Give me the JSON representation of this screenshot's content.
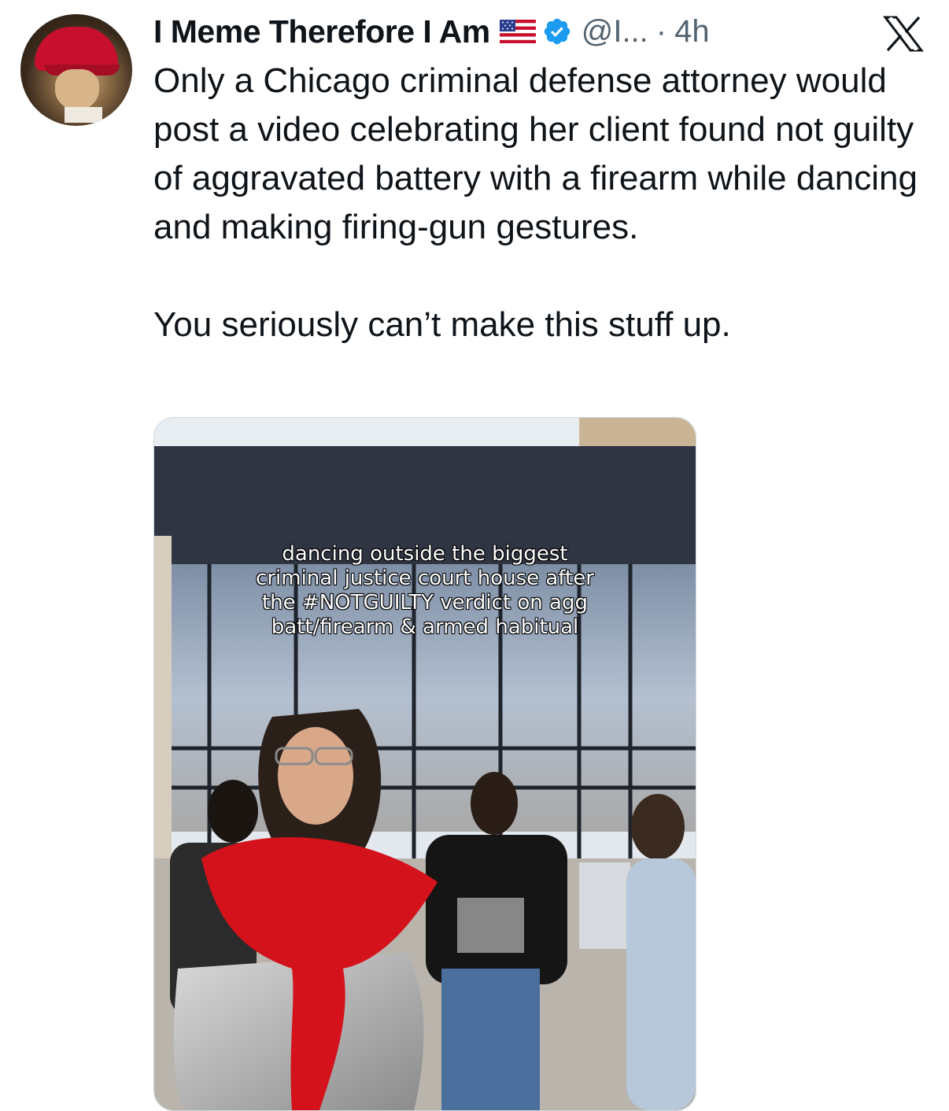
{
  "author": {
    "display_name": "I Meme Therefore I Am",
    "handle": "@I...",
    "separator": "·",
    "timestamp": "4h",
    "flag_icon": "us-flag-icon",
    "verified_icon": "verified-badge-icon",
    "verified_color": "#1d9bf0"
  },
  "platform": {
    "logo_icon": "x-logo-icon"
  },
  "tweet": {
    "paragraph_1": "Only a Chicago criminal defense attorney would post a video celebrating her client found not guilty of aggravated battery with a firearm while dancing and making firing-gun gestures.",
    "paragraph_2": "You seriously can’t make this stuff up."
  },
  "media": {
    "caption_lines": [
      "dancing outside the biggest",
      "criminal justice court house after",
      "the #NOTGUILTY verdict on agg",
      "batt/firearm & armed habitual"
    ]
  },
  "colors": {
    "text_primary": "#0f1419",
    "text_secondary": "#536471",
    "scarf_red": "#d4121b"
  }
}
